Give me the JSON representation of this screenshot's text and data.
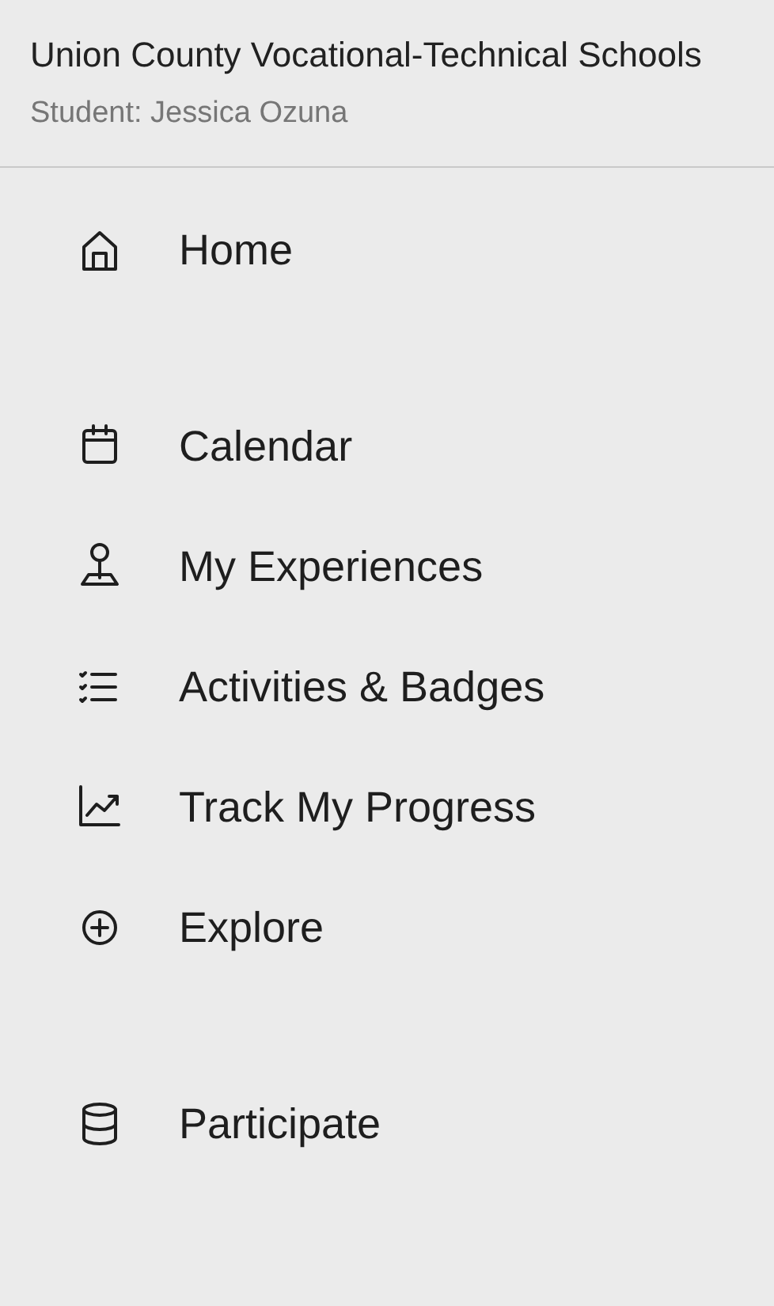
{
  "header": {
    "school": "Union County Vocational-Technical Schools",
    "student": "Student: Jessica Ozuna"
  },
  "nav_groups": [
    {
      "items": [
        {
          "label": "Home"
        }
      ]
    },
    {
      "items": [
        {
          "label": "Calendar"
        },
        {
          "label": "My Experiences"
        },
        {
          "label": "Activities & Badges"
        },
        {
          "label": "Track My Progress"
        },
        {
          "label": "Explore"
        }
      ]
    },
    {
      "items": [
        {
          "label": "Participate"
        }
      ]
    }
  ]
}
